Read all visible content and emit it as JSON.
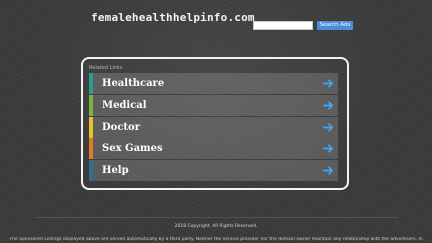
{
  "header": {
    "site_title": "femalehealthhelpinfo.com",
    "search": {
      "value": "",
      "button_label": "Search Ads"
    }
  },
  "related": {
    "heading": "Related Links",
    "items": [
      {
        "label": "Healthcare",
        "accent": "#2a9d8f",
        "icon": "arrow-right-icon"
      },
      {
        "label": "Medical",
        "accent": "#7cb342",
        "icon": "arrow-right-icon"
      },
      {
        "label": "Doctor",
        "accent": "#e6c229",
        "icon": "arrow-right-icon"
      },
      {
        "label": "Sex Games",
        "accent": "#e07b24",
        "icon": "arrow-right-icon"
      },
      {
        "label": "Help",
        "accent": "#2f6f8f",
        "icon": "arrow-right-icon"
      }
    ]
  },
  "footer": {
    "copyright": "2018 Copyright. All Rights Reserved.",
    "disclaimer": "The Sponsored Listings displayed above are served automatically by a third party. Neither the service provider nor the domain owner maintain any relationship with the advertisers. In"
  },
  "colors": {
    "background": "#3b3b3b",
    "panel_border": "#f2f2f2",
    "arrow": "#3fa9f5",
    "search_button": "#4c8ed6"
  }
}
